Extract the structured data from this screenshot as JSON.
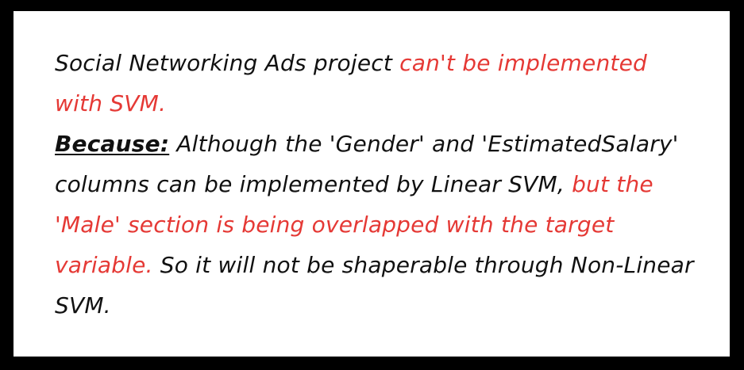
{
  "colors": {
    "background": "#000000",
    "card": "#ffffff",
    "text": "#111111",
    "highlight": "#e53935"
  },
  "note": {
    "p1_black": "Social Networking Ads project ",
    "p1_red": "can't be implemented with SVM.",
    "because_label": "Because:",
    "p2_black_1": " Although the 'Gender' and 'EstimatedSalary' columns can be implemented by Linear SVM, ",
    "p2_red": "but the 'Male' section is being overlapped with the target variable.",
    "p2_black_2": " So it will not be shaperable through Non-Linear SVM."
  }
}
